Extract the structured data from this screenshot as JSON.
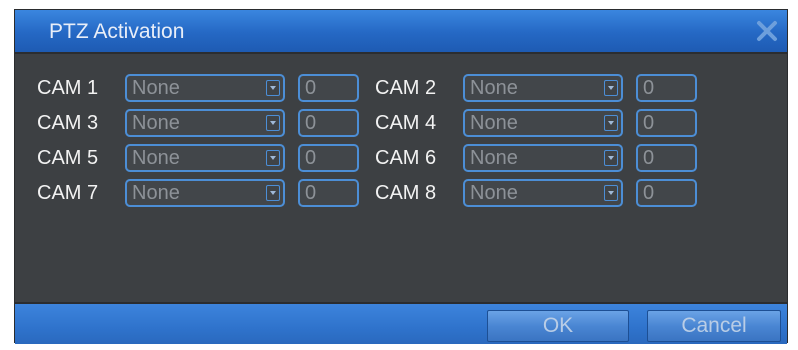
{
  "dialog": {
    "title": "PTZ Activation",
    "close_icon": "close-icon"
  },
  "cameras": [
    {
      "label": "CAM 1",
      "preset_type": "None",
      "value": "0"
    },
    {
      "label": "CAM 2",
      "preset_type": "None",
      "value": "0"
    },
    {
      "label": "CAM 3",
      "preset_type": "None",
      "value": "0"
    },
    {
      "label": "CAM 4",
      "preset_type": "None",
      "value": "0"
    },
    {
      "label": "CAM 5",
      "preset_type": "None",
      "value": "0"
    },
    {
      "label": "CAM 6",
      "preset_type": "None",
      "value": "0"
    },
    {
      "label": "CAM 7",
      "preset_type": "None",
      "value": "0"
    },
    {
      "label": "CAM 8",
      "preset_type": "None",
      "value": "0"
    }
  ],
  "buttons": {
    "ok_label": "OK",
    "cancel_label": "Cancel"
  },
  "colors": {
    "title_bar": "#2a6fcb",
    "panel_background": "#3d4043",
    "field_border": "#4c8ed6",
    "label_text": "#f2f2f2",
    "disabled_text": "#8d9298"
  }
}
